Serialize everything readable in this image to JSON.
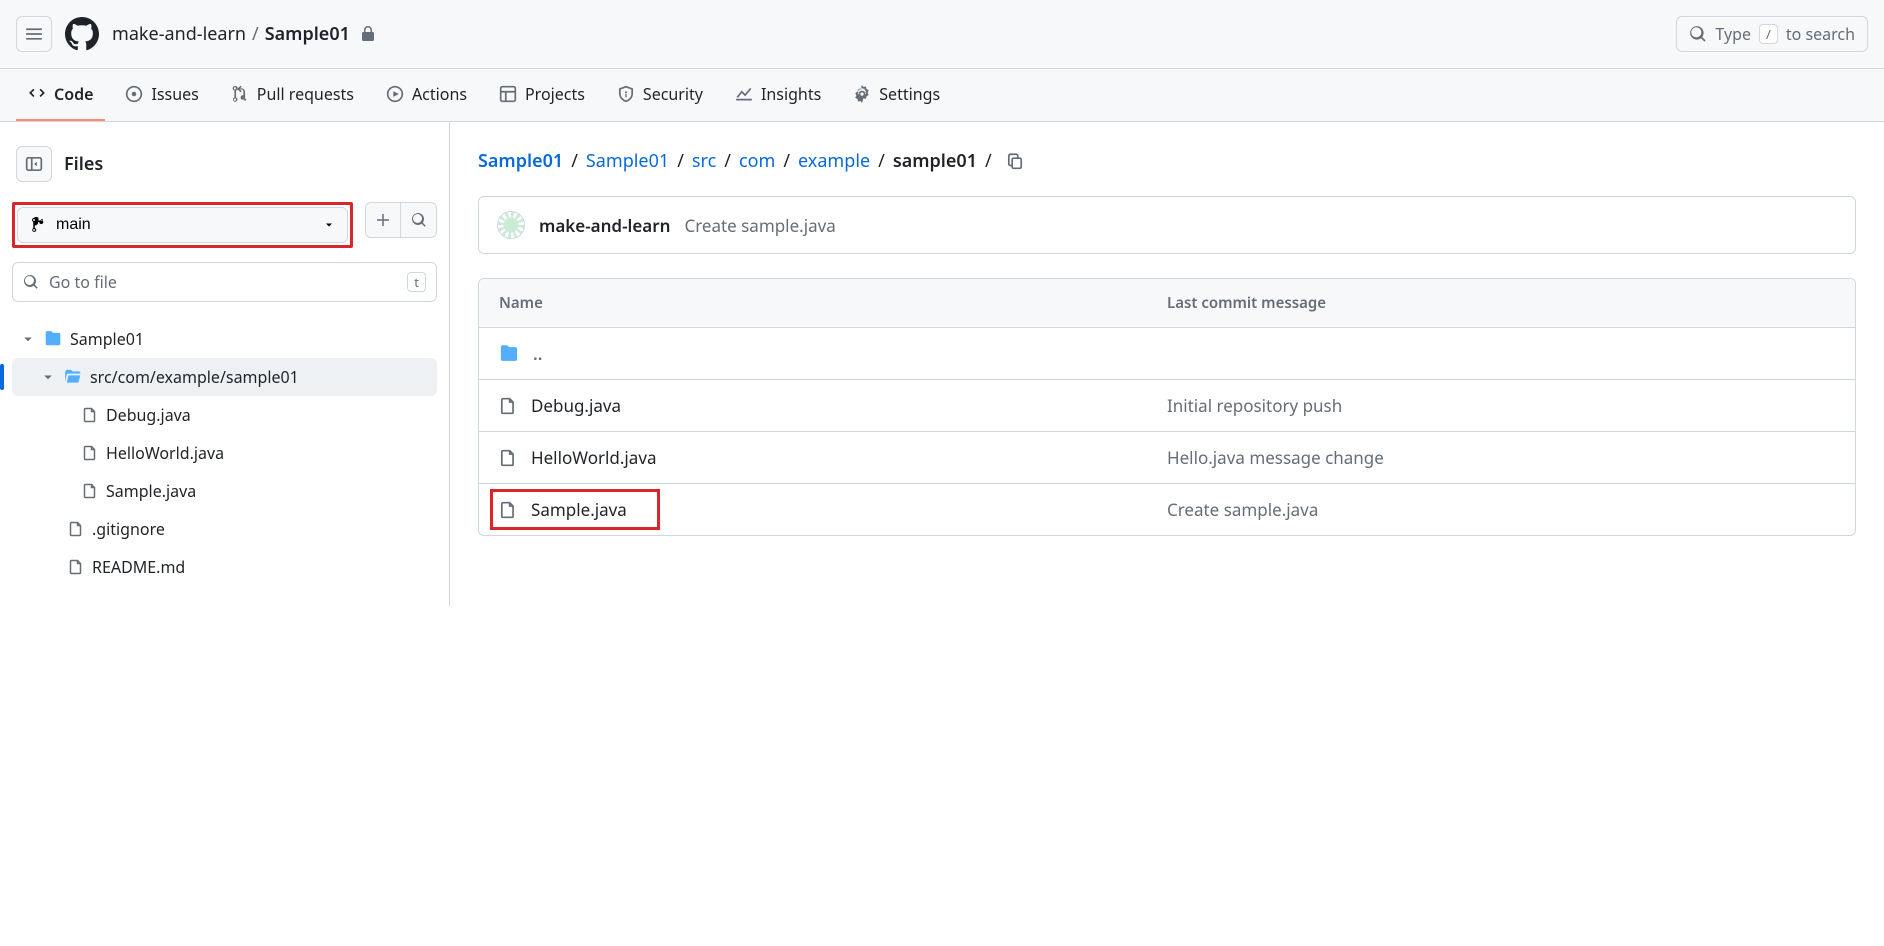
{
  "header": {
    "owner": "make-and-learn",
    "repo": "Sample01",
    "search_prefix": "Type",
    "search_key": "/",
    "search_suffix": "to search"
  },
  "tabs": [
    {
      "id": "code",
      "label": "Code",
      "active": true
    },
    {
      "id": "issues",
      "label": "Issues"
    },
    {
      "id": "pulls",
      "label": "Pull requests"
    },
    {
      "id": "actions",
      "label": "Actions"
    },
    {
      "id": "projects",
      "label": "Projects"
    },
    {
      "id": "security",
      "label": "Security"
    },
    {
      "id": "insights",
      "label": "Insights"
    },
    {
      "id": "settings",
      "label": "Settings"
    }
  ],
  "sidebar": {
    "title": "Files",
    "branch": "main",
    "goto_placeholder": "Go to file",
    "goto_key": "t",
    "tree": {
      "root": "Sample01",
      "folder": "src/com/example/sample01",
      "files_in_folder": [
        "Debug.java",
        "HelloWorld.java",
        "Sample.java"
      ],
      "root_files": [
        ".gitignore",
        "README.md"
      ]
    }
  },
  "path": {
    "segments": [
      "Sample01",
      "Sample01",
      "src",
      "com",
      "example"
    ],
    "last": "sample01"
  },
  "latest_commit": {
    "author": "make-and-learn",
    "message": "Create sample.java"
  },
  "table": {
    "col_name": "Name",
    "col_msg": "Last commit message",
    "parent": "..",
    "rows": [
      {
        "name": "Debug.java",
        "msg": "Initial repository push",
        "hl": false
      },
      {
        "name": "HelloWorld.java",
        "msg": "Hello.java message change",
        "hl": false
      },
      {
        "name": "Sample.java",
        "msg": "Create sample.java",
        "hl": true
      }
    ]
  }
}
